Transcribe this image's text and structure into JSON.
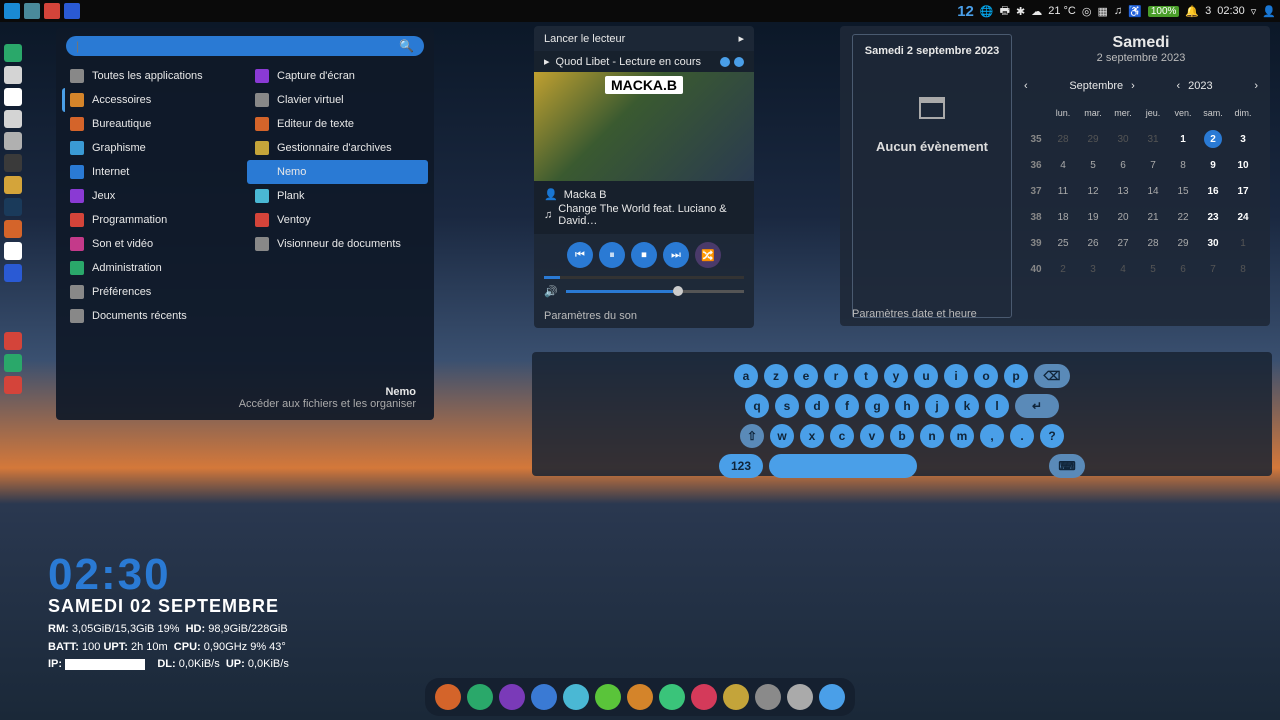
{
  "topbar": {
    "workspace": "12",
    "temp": "21 °C",
    "battery": "100%",
    "notif": "3",
    "time": "02:30"
  },
  "appmenu": {
    "search_placeholder": "|",
    "categories": [
      "Toutes les applications",
      "Accessoires",
      "Bureautique",
      "Graphisme",
      "Internet",
      "Jeux",
      "Programmation",
      "Son et vidéo",
      "Administration",
      "Préférences",
      "Documents récents"
    ],
    "active_category": "Accessoires",
    "apps": [
      "Capture d'écran",
      "Clavier virtuel",
      "Editeur de texte",
      "Gestionnaire d'archives",
      "Nemo",
      "Plank",
      "Ventoy",
      "Visionneur de documents"
    ],
    "selected_app": "Nemo",
    "desc_title": "Nemo",
    "desc_sub": "Accéder aux fichiers et les organiser"
  },
  "player": {
    "header": "Lancer le lecteur",
    "subtitle": "Quod Libet - Lecture en cours",
    "album_logo": "MACKA.B",
    "artist": "Macka B",
    "track": "Change The World feat. Luciano & David…",
    "footer": "Paramètres du son"
  },
  "calendar": {
    "events_title": "Samedi 2 septembre 2023",
    "no_events": "Aucun évènement",
    "day_name": "Samedi",
    "full_date": "2 septembre 2023",
    "month": "Septembre",
    "year": "2023",
    "weekday_headers": [
      "lun.",
      "mar.",
      "mer.",
      "jeu.",
      "ven.",
      "sam.",
      "dim."
    ],
    "weeks": [
      {
        "wk": "35",
        "days": [
          {
            "d": "28",
            "m": true
          },
          {
            "d": "29",
            "m": true
          },
          {
            "d": "30",
            "m": true
          },
          {
            "d": "31",
            "m": true
          },
          {
            "d": "1",
            "c": true
          },
          {
            "d": "2",
            "c": true,
            "today": true
          },
          {
            "d": "3",
            "c": true
          }
        ]
      },
      {
        "wk": "36",
        "days": [
          {
            "d": "4"
          },
          {
            "d": "5"
          },
          {
            "d": "6"
          },
          {
            "d": "7"
          },
          {
            "d": "8"
          },
          {
            "d": "9",
            "c": true
          },
          {
            "d": "10",
            "c": true
          }
        ]
      },
      {
        "wk": "37",
        "days": [
          {
            "d": "11"
          },
          {
            "d": "12"
          },
          {
            "d": "13"
          },
          {
            "d": "14"
          },
          {
            "d": "15"
          },
          {
            "d": "16",
            "c": true
          },
          {
            "d": "17",
            "c": true
          }
        ]
      },
      {
        "wk": "38",
        "days": [
          {
            "d": "18"
          },
          {
            "d": "19"
          },
          {
            "d": "20"
          },
          {
            "d": "21"
          },
          {
            "d": "22"
          },
          {
            "d": "23",
            "c": true
          },
          {
            "d": "24",
            "c": true
          }
        ]
      },
      {
        "wk": "39",
        "days": [
          {
            "d": "25"
          },
          {
            "d": "26"
          },
          {
            "d": "27"
          },
          {
            "d": "28"
          },
          {
            "d": "29"
          },
          {
            "d": "30",
            "c": true
          },
          {
            "d": "1",
            "m": true
          }
        ]
      },
      {
        "wk": "40",
        "days": [
          {
            "d": "2",
            "m": true
          },
          {
            "d": "3",
            "m": true
          },
          {
            "d": "4",
            "m": true
          },
          {
            "d": "5",
            "m": true
          },
          {
            "d": "6",
            "m": true
          },
          {
            "d": "7",
            "m": true
          },
          {
            "d": "8",
            "m": true
          }
        ]
      }
    ],
    "footer": "Paramètres date et heure"
  },
  "keyboard": {
    "row1": [
      "a",
      "z",
      "e",
      "r",
      "t",
      "y",
      "u",
      "i",
      "o",
      "p"
    ],
    "row2": [
      "q",
      "s",
      "d",
      "f",
      "g",
      "h",
      "j",
      "k",
      "l"
    ],
    "row3": [
      "w",
      "x",
      "c",
      "v",
      "b",
      "n",
      "m",
      ",",
      ".",
      "?"
    ],
    "num_key": "123"
  },
  "conky": {
    "time": "02:30",
    "day": "SAMEDI 02 SEPTEMBRE",
    "rm_label": "RM:",
    "rm_val": "3,05GiB/15,3GiB 19%",
    "hd_label": "HD:",
    "hd_val": "98,9GiB/228GiB",
    "batt_label": "BATT:",
    "batt_val": "100",
    "upt_label": "UPT:",
    "upt_val": "2h 10m",
    "cpu_label": "CPU:",
    "cpu_val": "0,90GHz 9% 43°",
    "ip_label": "IP:",
    "dl_label": "DL:",
    "dl_val": "0,0KiB/s",
    "up_label": "UP:",
    "up_val": "0,0KiB/s"
  },
  "dock_colors": [
    "#d4642a",
    "#2aa86a",
    "#7a3ab8",
    "#3a7ad4",
    "#4ab8d4",
    "#5ac43a",
    "#d4842a",
    "#3ac47a",
    "#d43a5a",
    "#c4a43a",
    "#8a8a8a",
    "#aaaaaa",
    "#4a9fe8"
  ]
}
